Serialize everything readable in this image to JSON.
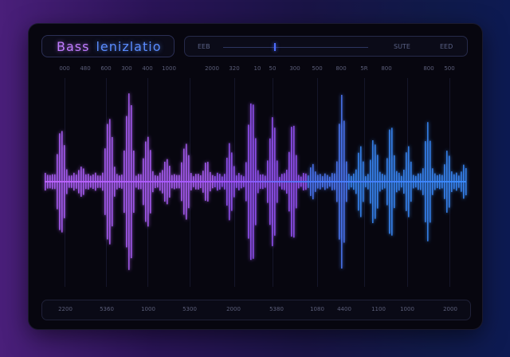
{
  "title": {
    "part1": "Bass",
    "part2": "lenizlatio"
  },
  "top_bar": {
    "left_label": "EEB",
    "mid_label": "SUTE",
    "right_label": "EED",
    "slider_value": 0.35
  },
  "scale_labels": [
    "000",
    "480",
    "600",
    "300",
    "400",
    "1000",
    "2000",
    "320",
    "10",
    "50",
    "300",
    "500",
    "800",
    "5R",
    "800",
    "800",
    "500"
  ],
  "bottom_labels": [
    "2200",
    "5360",
    "1000",
    "5300",
    "2000",
    "5380",
    "1080",
    "4400",
    "1100",
    "1000",
    "2000"
  ],
  "colors": {
    "purple": "#b266ff",
    "blue": "#3f86ff",
    "panel": "#07060f"
  }
}
